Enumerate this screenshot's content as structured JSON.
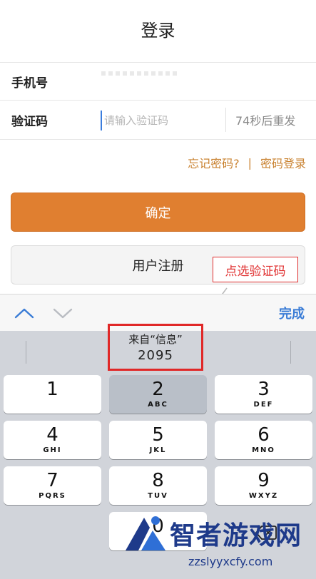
{
  "header": {
    "title": "登录"
  },
  "form": {
    "phone_label": "手机号",
    "code_label": "验证码",
    "code_placeholder": "请输入验证码",
    "code_value": "",
    "resend_label": "74秒后重发"
  },
  "links": {
    "forgot": "忘记密码?",
    "separator": "|",
    "password_login": "密码登录"
  },
  "buttons": {
    "confirm": "确定",
    "register": "用户注册"
  },
  "annotation": {
    "text": "点选验证码"
  },
  "toolbar": {
    "up_icon": "chevron-up",
    "down_icon": "chevron-down",
    "done": "完成"
  },
  "keyboard": {
    "suggestion": {
      "source": "来自“信息”",
      "code": "2095"
    },
    "keys": [
      {
        "num": "1",
        "letters": ""
      },
      {
        "num": "2",
        "letters": "ABC"
      },
      {
        "num": "3",
        "letters": "DEF"
      },
      {
        "num": "4",
        "letters": "GHI"
      },
      {
        "num": "5",
        "letters": "JKL"
      },
      {
        "num": "6",
        "letters": "MNO"
      },
      {
        "num": "7",
        "letters": "PQRS"
      },
      {
        "num": "8",
        "letters": "TUV"
      },
      {
        "num": "9",
        "letters": "WXYZ"
      },
      {
        "num": "0",
        "letters": ""
      }
    ]
  },
  "watermark": {
    "name": "智者游戏网",
    "url": "zzslyyxcfy.com"
  },
  "colors": {
    "accent": "#e07f30",
    "link": "#c98230",
    "keyboard_bg": "#d1d4da",
    "annotation": "#e02828",
    "toolbar_done": "#3a7cd6"
  }
}
